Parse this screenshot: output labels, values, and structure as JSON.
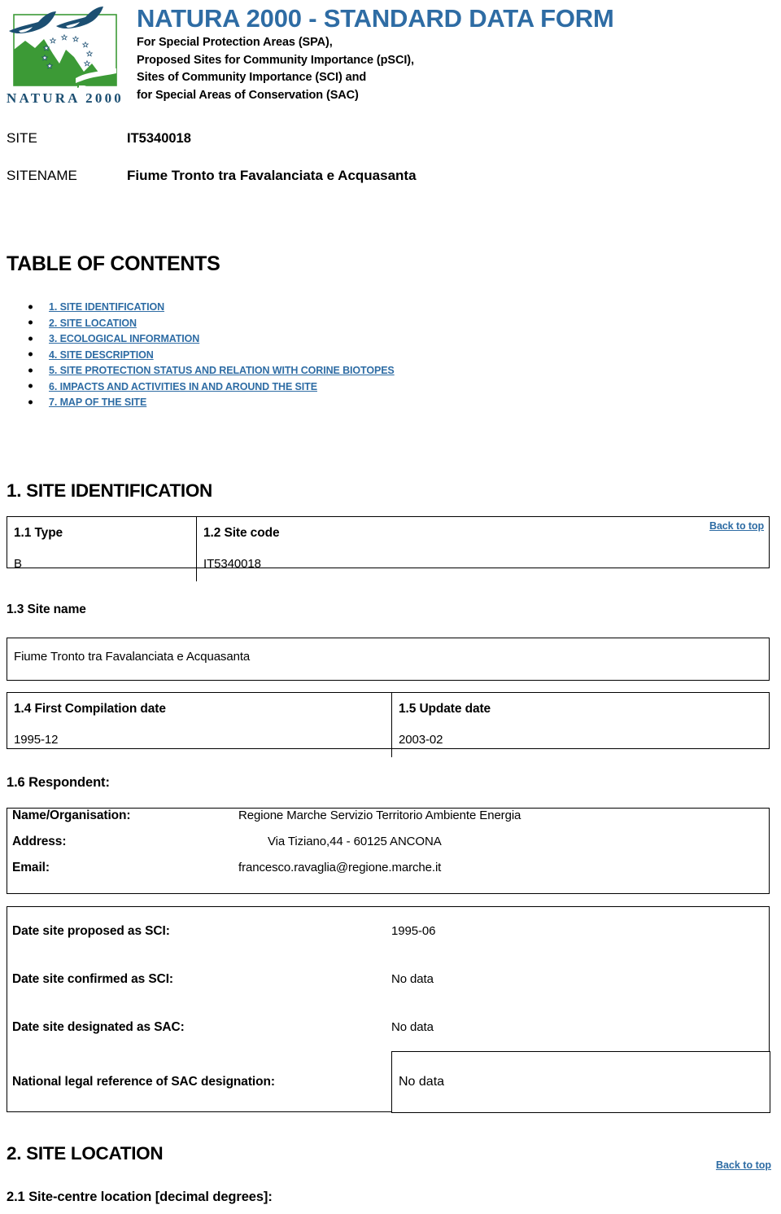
{
  "header": {
    "title": "NATURA 2000 - STANDARD DATA FORM",
    "subtitle_lines": [
      "For Special Protection Areas (SPA),",
      "Proposed Sites for Community Importance (pSCI),",
      "Sites of Community Importance (SCI) and",
      "for Special Areas of Conservation (SAC)"
    ],
    "logo_caption": "NATURA 2000"
  },
  "site_header": {
    "site_label": "SITE",
    "site_value": "IT5340018",
    "sitename_label": "SITENAME",
    "sitename_value": "Fiume Tronto tra Favalanciata e Acquasanta"
  },
  "toc": {
    "title": "TABLE OF CONTENTS",
    "items": [
      {
        "label": "1. SITE IDENTIFICATION"
      },
      {
        "label": "2. SITE LOCATION"
      },
      {
        "label": "3. ECOLOGICAL INFORMATION"
      },
      {
        "label": "4. SITE DESCRIPTION"
      },
      {
        "label": "5. SITE PROTECTION STATUS AND RELATION WITH CORINE BIOTOPES"
      },
      {
        "label": "6. IMPACTS AND ACTIVITIES IN AND AROUND THE SITE"
      },
      {
        "label": "7. MAP OF THE SITE"
      }
    ]
  },
  "back_to_top": "Back to top",
  "section1": {
    "heading": "1. SITE IDENTIFICATION",
    "type": {
      "label": "1.1 Type",
      "value": "B"
    },
    "site_code": {
      "label": "1.2 Site code",
      "value": "IT5340018"
    },
    "site_name": {
      "label": "1.3 Site name",
      "value": "Fiume Tronto tra Favalanciata e Acquasanta"
    },
    "first_compilation": {
      "label": "1.4 First Compilation date",
      "value": "1995-12"
    },
    "update_date": {
      "label": "1.5 Update date",
      "value": "2003-02"
    },
    "respondent": {
      "heading": "1.6 Respondent:",
      "name_label": "Name/Organisation:",
      "name_value": "Regione Marche Servizio Territorio Ambiente Energia",
      "address_label": "Address:",
      "address_value": "Via Tiziano,44 - 60125 ANCONA",
      "email_label": "Email:",
      "email_value": "francesco.ravaglia@regione.marche.it"
    },
    "designation": {
      "proposed_label": "Date site proposed as SCI:",
      "proposed_value": "1995-06",
      "confirmed_label": "Date site confirmed as SCI:",
      "confirmed_value": "No data",
      "designated_label": "Date site designated as SAC:",
      "designated_value": "No data",
      "legal_ref_label": "National legal reference of SAC designation:",
      "legal_ref_value": "No data"
    }
  },
  "section2": {
    "heading": "2. SITE LOCATION",
    "site_centre_label": "2.1 Site-centre location [decimal degrees]:"
  },
  "colors": {
    "link": "#2E6CA4",
    "title": "#2E6CA4",
    "logo_green": "#3C9A36",
    "logo_blue": "#1C4F72",
    "border": "#000000"
  }
}
